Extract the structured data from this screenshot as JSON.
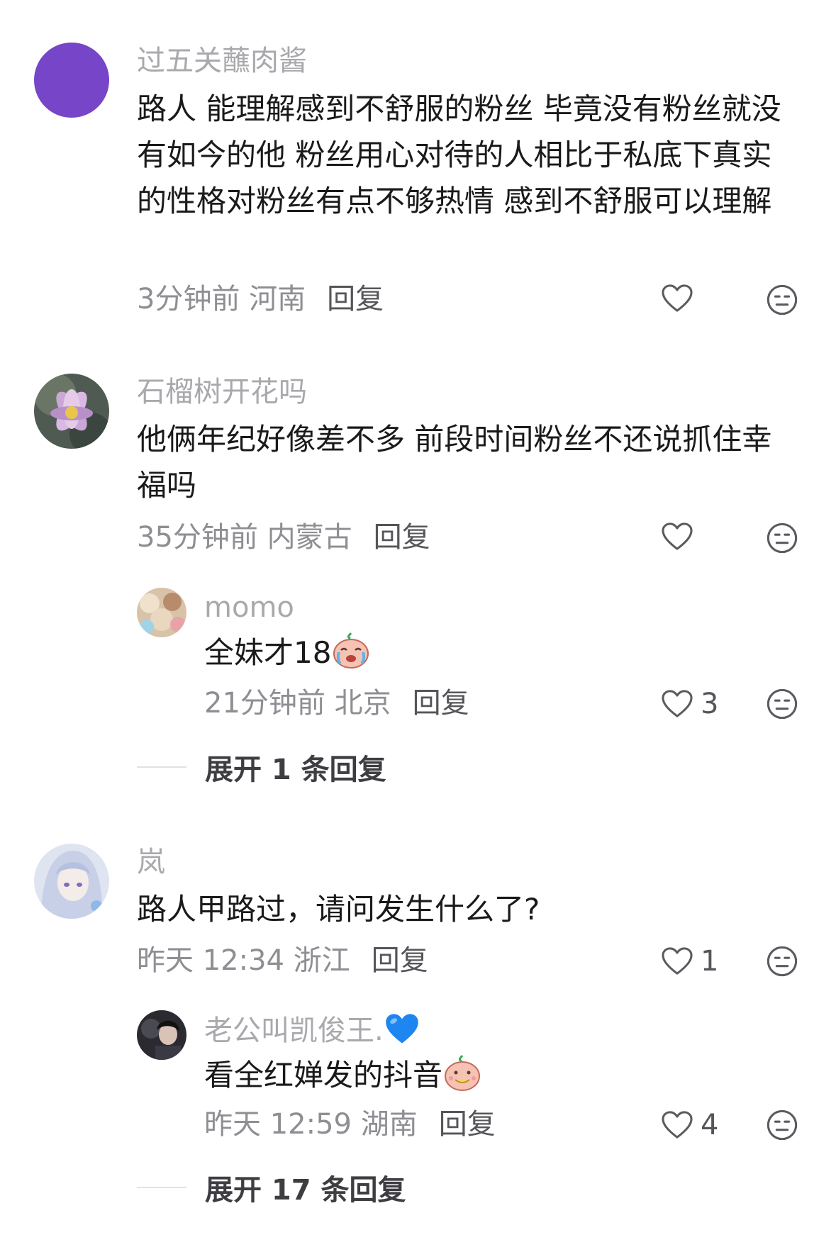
{
  "comments": [
    {
      "username": "过五关蘸肉酱",
      "text": "路人 能理解感到不舒服的粉丝 毕竟没有粉丝就没有如今的他 粉丝用心对待的人相比于私底下真实的性格对粉丝有点不够热情 感到不舒服可以理解",
      "time_location": "3分钟前 河南",
      "reply_label": "回复",
      "likes": ""
    },
    {
      "username": "石榴树开花吗",
      "text": "他俩年纪好像差不多 前段时间粉丝不还说抓住幸福吗",
      "time_location": "35分钟前 内蒙古",
      "reply_label": "回复",
      "likes": "",
      "replies": [
        {
          "username": "momo",
          "text": "全妹才18",
          "emoji": "crying-face",
          "time_location": "21分钟前 北京",
          "reply_label": "回复",
          "likes": "3"
        }
      ],
      "expand_label": "展开 1 条回复"
    },
    {
      "username": "岚",
      "text": "路人甲路过，请问发生什么了?",
      "time_location": "昨天 12:34 浙江",
      "reply_label": "回复",
      "likes": "1",
      "replies": [
        {
          "username": "老公叫凯俊王.",
          "username_emoji": "blue-heart",
          "text": "看全红婵发的抖音",
          "emoji": "eating-face",
          "time_location": "昨天 12:59 湖南",
          "reply_label": "回复",
          "likes": "4"
        }
      ],
      "expand_label": "展开 17 条回复"
    }
  ],
  "colors": {
    "avatar_purple": "#7645c8",
    "username": "#a9a9ad",
    "meta": "#8e8e93",
    "text": "#1a1a1a"
  }
}
